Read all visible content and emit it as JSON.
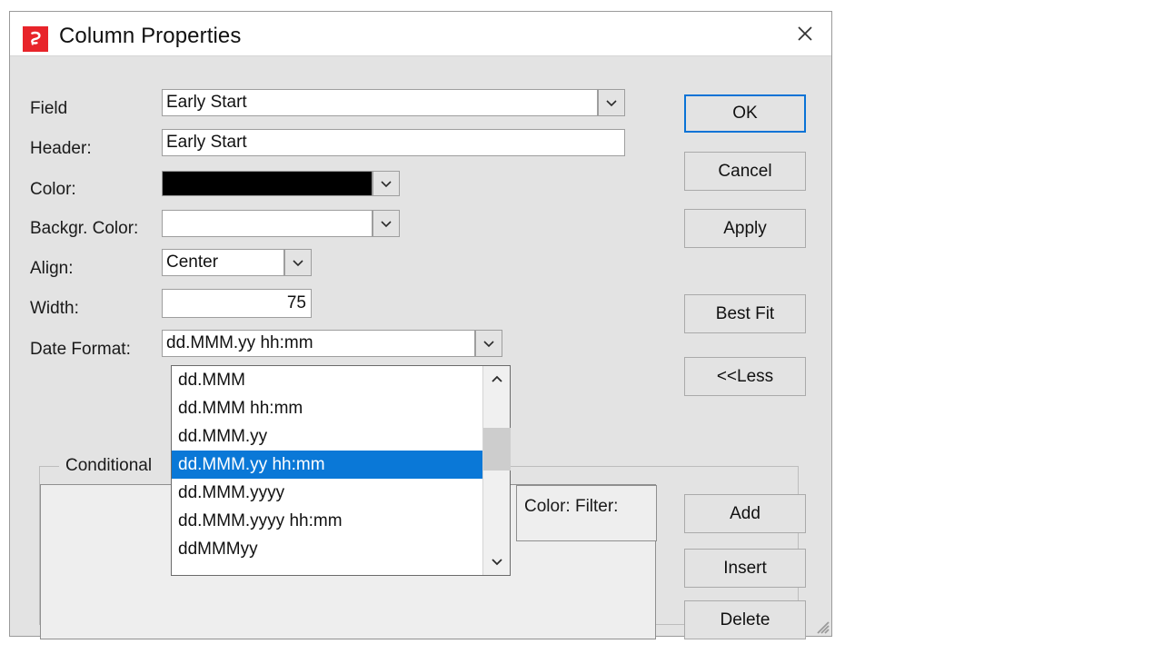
{
  "window": {
    "title": "Column Properties",
    "icon": "app-logo-icon",
    "close_icon": "close-icon",
    "accent_color": "#0a78d7",
    "logo_color": "#e8242a",
    "face_color": "#e3e3e3"
  },
  "form": {
    "rows": [
      {
        "label": "Field",
        "value": "Early Start",
        "kind": "combo"
      },
      {
        "label": "Header:",
        "value": "Early Start",
        "kind": "text"
      },
      {
        "label": "Color:",
        "value": "#000000",
        "kind": "color"
      },
      {
        "label": "Backgr. Color:",
        "value": "#ffffff",
        "kind": "color"
      },
      {
        "label": "Align:",
        "value": "Center",
        "kind": "combo"
      },
      {
        "label": "Width:",
        "value": "75",
        "kind": "number"
      },
      {
        "label": "Date Format:",
        "value": "dd.MMM.yy hh:mm",
        "kind": "combo"
      }
    ]
  },
  "date_format_dropdown": {
    "expanded": true,
    "selected": "dd.MMM.yy hh:mm",
    "options": [
      "dd.MMM",
      "dd.MMM hh:mm",
      "dd.MMM.yy",
      "dd.MMM.yy hh:mm",
      "dd.MMM.yyyy",
      "dd.MMM.yyyy hh:mm",
      "ddMMMyy"
    ],
    "scrollbar": {
      "up_icon": "chevron-up-icon",
      "down_icon": "chevron-down-icon"
    }
  },
  "conditional": {
    "legend": "Conditional",
    "column_headers": "Color: Filter:"
  },
  "buttons": {
    "ok": "OK",
    "cancel": "Cancel",
    "apply": "Apply",
    "best_fit": "Best Fit",
    "less": "<<Less",
    "add": "Add",
    "insert": "Insert",
    "delete": "Delete"
  }
}
